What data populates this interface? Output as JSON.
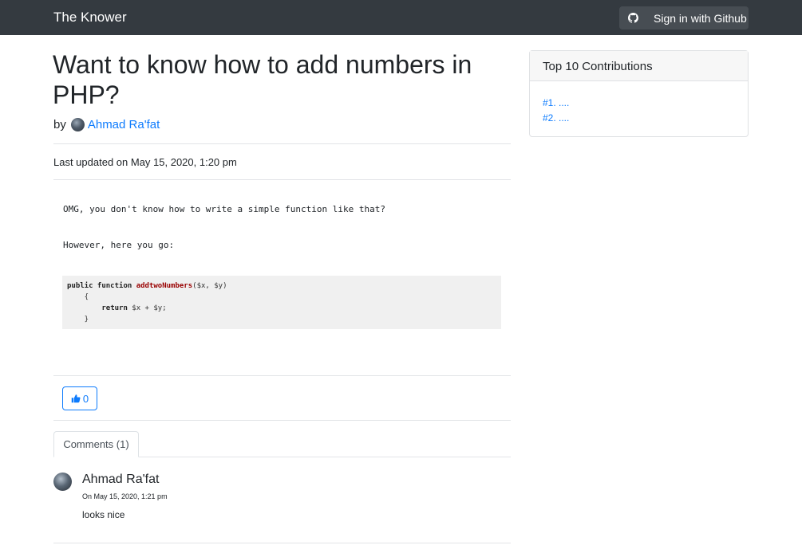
{
  "navbar": {
    "brand": "The Knower",
    "signin_label": "Sign in with Github",
    "signin_icon": "github-icon"
  },
  "post": {
    "title": "Want to know how to add numbers in PHP?",
    "by_label": "by",
    "author": "Ahmad Ra'fat",
    "last_updated": "Last updated on May 15, 2020, 1:20 pm",
    "paragraph1": "OMG, you don't know how to write a simple function like that?",
    "paragraph2": "However, here you go:",
    "code": {
      "line1_kw": "public function",
      "line1_fn": "addtwoNumbers",
      "line1_args": "($x, $y)",
      "line2": "    {",
      "line3_kw": "return",
      "line3_rest": " $x + $y;",
      "line4": "    }"
    },
    "likes": "0",
    "like_icon": "thumbs-up-icon"
  },
  "comments": {
    "tab_label": "Comments (1)",
    "items": [
      {
        "author": "Ahmad Ra'fat",
        "date": "On May 15, 2020, 1:21 pm",
        "text": "looks nice"
      }
    ]
  },
  "sidebar": {
    "header": "Top 10 Contributions",
    "items": [
      "#1. ....",
      "#2. ...."
    ]
  },
  "colors": {
    "navbar_bg": "#343a40",
    "link": "#0d7bfd",
    "code_function": "#990000"
  }
}
